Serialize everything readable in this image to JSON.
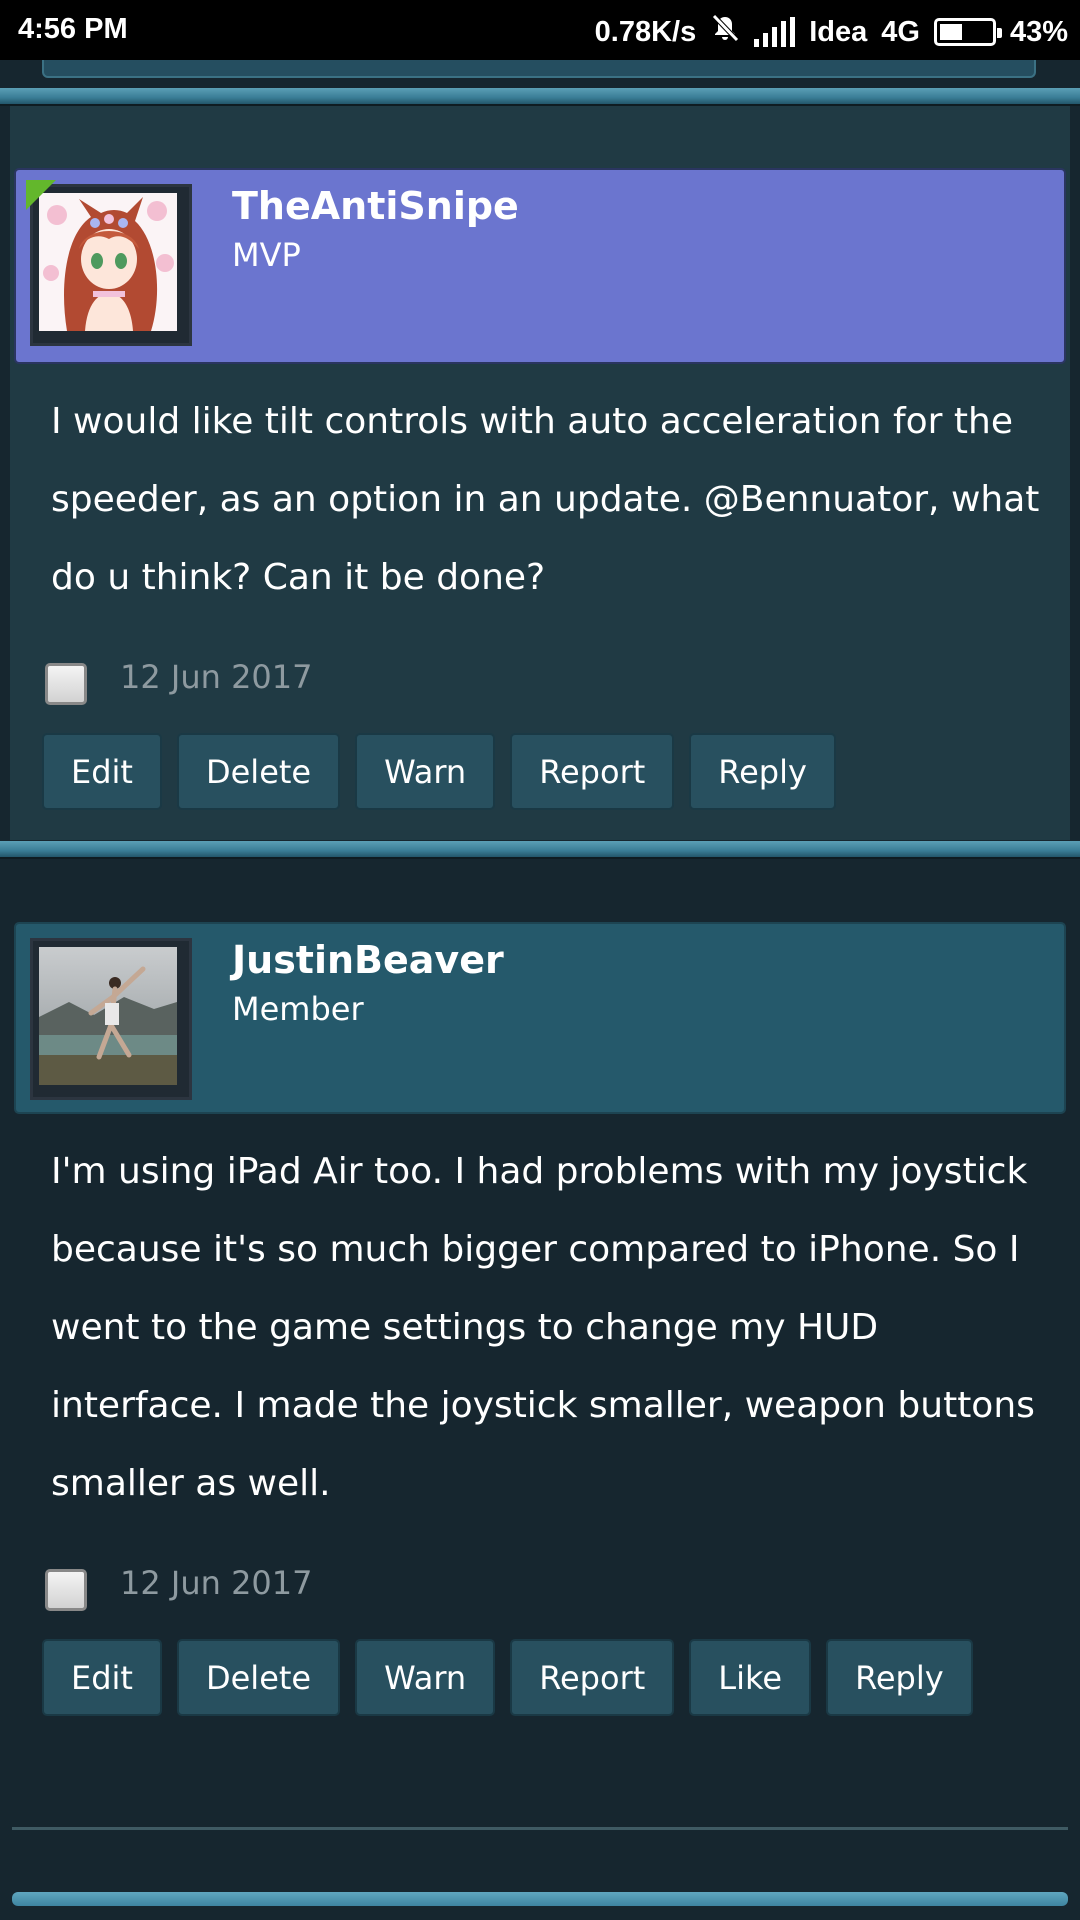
{
  "status_bar": {
    "time": "4:56 PM",
    "speed": "0.78K/s",
    "carrier": "Idea",
    "network": "4G",
    "battery": "43%",
    "battery_level": 0.43
  },
  "posts": [
    {
      "username": "TheAntiSnipe",
      "role": "MVP",
      "online": true,
      "body": "I would like tilt controls with auto acceleration for the speeder, as an option in an update. @Bennuator, what do u think? Can it be done?",
      "date": "12 Jun 2017",
      "buttons": [
        "Edit",
        "Delete",
        "Warn",
        "Report",
        "Reply"
      ]
    },
    {
      "username": "JustinBeaver",
      "role": "Member",
      "online": false,
      "body": "I'm using iPad Air too. I had problems with my joystick because it's so much bigger compared to iPhone. So I went to the game settings to change my HUD interface. I made the joystick smaller, weapon buttons smaller as well.",
      "date": "12 Jun 2017",
      "buttons": [
        "Edit",
        "Delete",
        "Warn",
        "Report",
        "Like",
        "Reply"
      ]
    }
  ]
}
